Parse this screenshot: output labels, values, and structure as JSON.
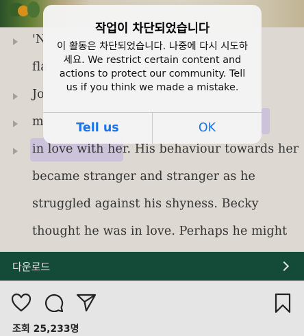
{
  "book": {
    "lines": [
      {
        "prefix": "'N",
        "rest": ""
      },
      {
        "prefix": "fla",
        "rest": ""
      },
      {
        "prefix": "Jo",
        "rest": ""
      },
      {
        "prefix": "m",
        "rest": ""
      },
      {
        "prefix": "",
        "rest": "in love with her. His behaviour towards her"
      },
      {
        "prefix": "",
        "rest": "became stranger and stranger as he"
      },
      {
        "prefix": "",
        "rest": "struggled against his shyness. Becky"
      },
      {
        "prefix": "",
        "rest": "thought he was in love. Perhaps he might"
      }
    ]
  },
  "alert": {
    "title": "작업이 차단되었습니다",
    "message": "이 활동은 차단되었습니다. 나중에 다시 시도하세요. We restrict certain content and actions to protect our community. Tell us if you think we made a mistake.",
    "button_left": "Tell us",
    "button_right": "OK"
  },
  "download_bar": {
    "label": "다운로드"
  },
  "actions": {
    "icons": [
      "heart-icon",
      "comment-icon",
      "share-icon",
      "bookmark-icon"
    ]
  },
  "views": {
    "text": "조회 25,233명"
  },
  "colors": {
    "download_bar_bg": "#17533f",
    "alert_button": "#1a73e8",
    "highlight": "#e4d9f3"
  }
}
